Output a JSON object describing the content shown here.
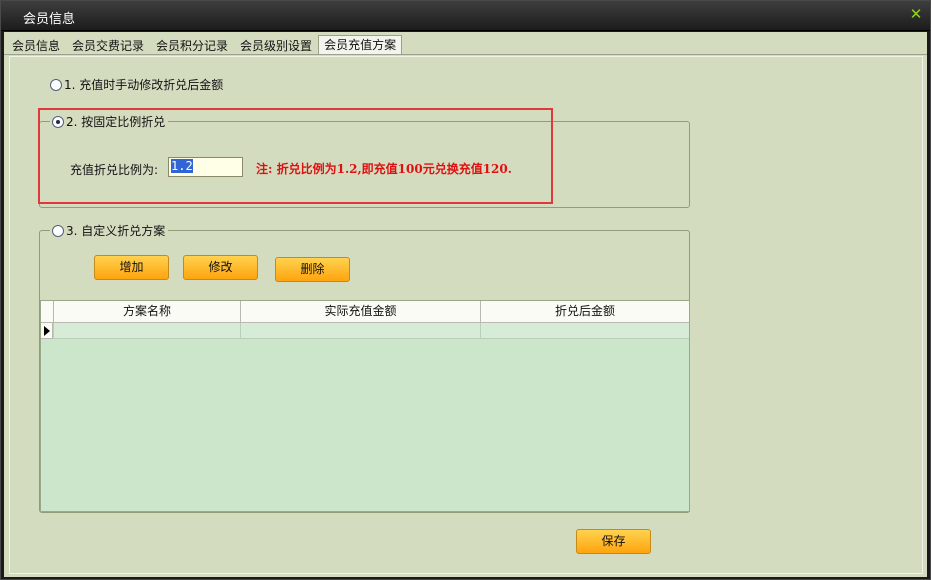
{
  "window": {
    "title": "会员信息",
    "close_glyph": "✕"
  },
  "tabs": [
    {
      "label": "会员信息",
      "active": false
    },
    {
      "label": "会员交费记录",
      "active": false
    },
    {
      "label": "会员积分记录",
      "active": false
    },
    {
      "label": "会员级别设置",
      "active": false
    },
    {
      "label": "会员充值方案",
      "active": true
    }
  ],
  "options": {
    "opt1": {
      "label": "1. 充值时手动修改折兑后金额",
      "checked": false
    },
    "opt2": {
      "label": "2. 按固定比例折兑",
      "checked": true
    },
    "opt3": {
      "label": "3. 自定义折兑方案",
      "checked": false
    }
  },
  "ratio": {
    "label": "充值折兑比例为:",
    "value": "1.2",
    "note": "注: 折兑比例为1.2,即充值100元兑换充值120."
  },
  "buttons": {
    "add": "增加",
    "edit": "修改",
    "delete": "删除",
    "save": "保存"
  },
  "grid": {
    "columns": [
      "方案名称",
      "实际充值金额",
      "折兑后金额"
    ],
    "rows": [
      [
        "",
        "",
        ""
      ]
    ]
  },
  "colors": {
    "highlight": "#e0383c",
    "note": "#e01010",
    "button": "#ffb020",
    "background": "#d4dcc0"
  }
}
